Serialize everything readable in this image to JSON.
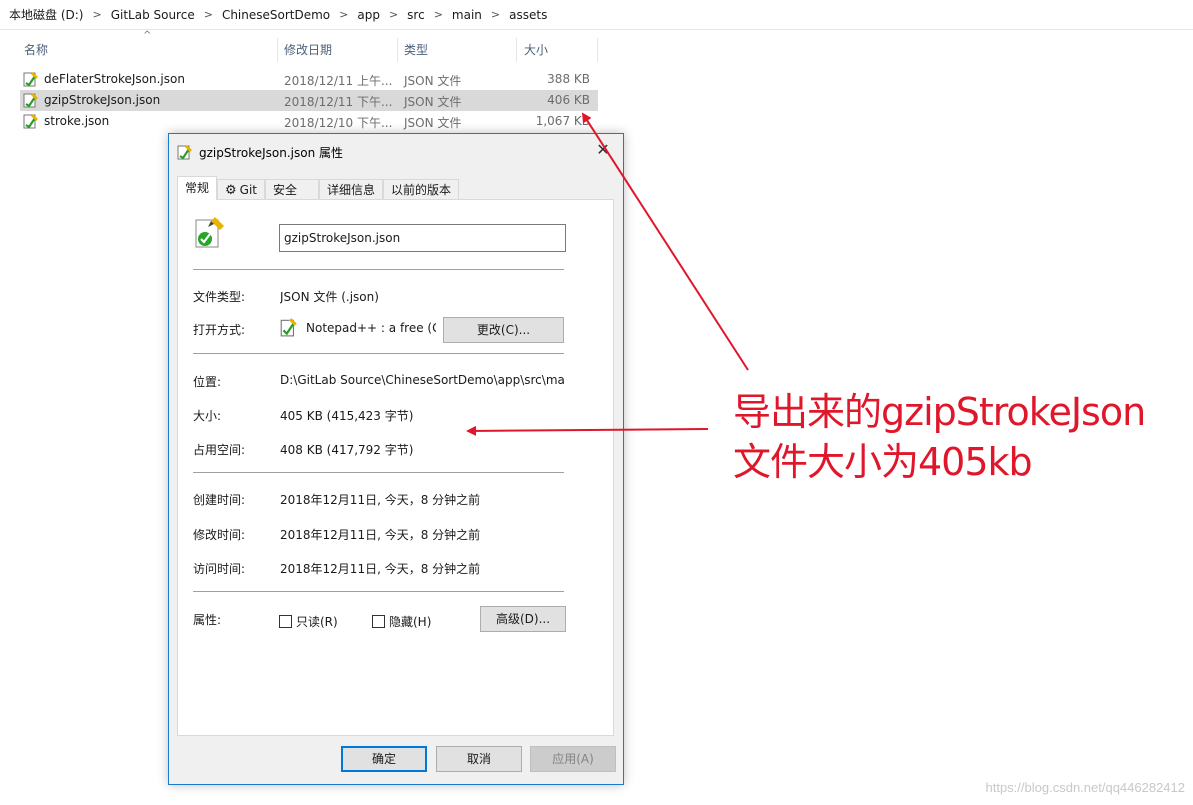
{
  "breadcrumb": [
    "本地磁盘 (D:)",
    "GitLab Source",
    "ChineseSortDemo",
    "app",
    "src",
    "main",
    "assets"
  ],
  "breadcrumb_separator": ">",
  "columns": {
    "name": "名称",
    "date": "修改日期",
    "type": "类型",
    "size": "大小"
  },
  "sort_indicator": "^",
  "files": [
    {
      "name": "deFlaterStrokeJson.json",
      "date": "2018/12/11 上午...",
      "type": "JSON 文件",
      "size": "388 KB"
    },
    {
      "name": "gzipStrokeJson.json",
      "date": "2018/12/11 下午...",
      "type": "JSON 文件",
      "size": "406 KB"
    },
    {
      "name": "stroke.json",
      "date": "2018/12/10 下午...",
      "type": "JSON 文件",
      "size": "1,067 KB"
    }
  ],
  "file_icon": "notepadpp-json-file-icon",
  "dialog": {
    "title": "gzipStrokeJson.json 属性",
    "close_glyph": "✕",
    "tabs": [
      "常规",
      "Git",
      "安全",
      "详细信息",
      "以前的版本"
    ],
    "filename_value": "gzipStrokeJson.json",
    "file_type_label": "文件类型:",
    "file_type_value": "JSON 文件 (.json)",
    "open_with_label": "打开方式:",
    "open_with_value": "Notepad++ : a free (G",
    "change_button": "更改(C)...",
    "location_label": "位置:",
    "location_value": "D:\\GitLab Source\\ChineseSortDemo\\app\\src\\main",
    "size_label": "大小:",
    "size_value": "405 KB (415,423 字节)",
    "disk_size_label": "占用空间:",
    "disk_size_value": "408 KB (417,792 字节)",
    "created_label": "创建时间:",
    "created_value": "2018年12月11日, 今天，8 分钟之前",
    "modified_label": "修改时间:",
    "modified_value": "2018年12月11日, 今天，8 分钟之前",
    "accessed_label": "访问时间:",
    "accessed_value": "2018年12月11日, 今天，8 分钟之前",
    "attributes_label": "属性:",
    "readonly_label": "只读(R)",
    "hidden_label": "隐藏(H)",
    "advanced_button": "高级(D)...",
    "ok_button": "确定",
    "cancel_button": "取消",
    "apply_button": "应用(A)"
  },
  "annotation": {
    "line1": "导出来的gzipStrokeJson",
    "line2": "文件大小为405kb",
    "color": "#e0162b"
  },
  "watermark": "https://blog.csdn.net/qq446282412"
}
